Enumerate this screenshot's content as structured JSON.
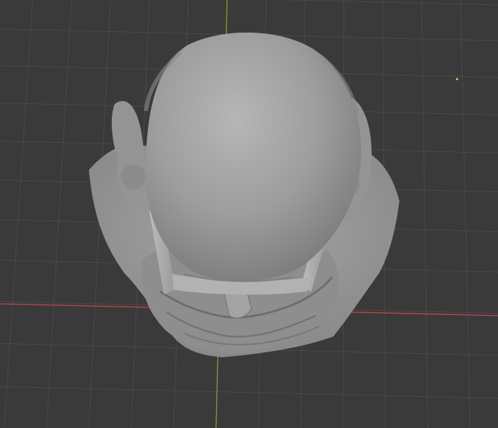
{
  "viewport": {
    "background_color": "#3a3a3a",
    "grid_line_color": "#4a4a4a",
    "x_axis_color": "#c0474d",
    "y_axis_color": "#7ea52e",
    "model_color": "#a8a8a8",
    "model_shadow_color": "#6f6f6f",
    "object_origin_color": "#f0e070",
    "model_object": "bust-model-top-view"
  }
}
